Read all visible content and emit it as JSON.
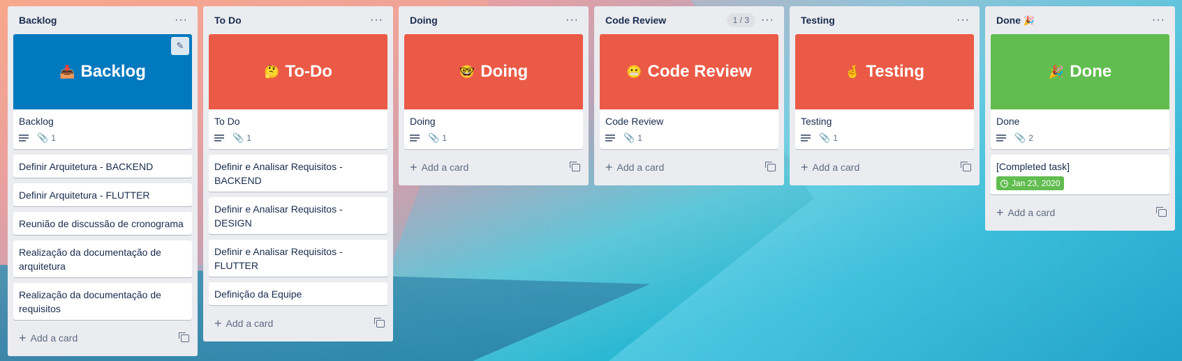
{
  "colors": {
    "blue": "#0079bf",
    "red": "#eb5a46",
    "green": "#61bd4f"
  },
  "lists": [
    {
      "title": "Backlog",
      "cover": {
        "emoji": "📥",
        "text": "Backlog"
      },
      "cover_card_title": "Backlog",
      "attachments": "1",
      "cards": [
        "Definir Arquitetura - BACKEND",
        "Definir Arquitetura - FLUTTER",
        "Reunião de discussão de cronograma",
        "Realização da documentação de arquitetura",
        "Realização da documentação de requisitos"
      ],
      "add_label": "Add a card"
    },
    {
      "title": "To Do",
      "cover": {
        "emoji": "🤔",
        "text": "To-Do"
      },
      "cover_card_title": "To Do",
      "attachments": "1",
      "cards": [
        "Definir e Analisar Requisitos - BACKEND",
        "Definir e Analisar Requisitos - DESIGN",
        "Definir e Analisar Requisitos - FLUTTER",
        "Definição da Equipe"
      ],
      "add_label": "Add a card"
    },
    {
      "title": "Doing",
      "cover": {
        "emoji": "🤓",
        "text": "Doing"
      },
      "cover_card_title": "Doing",
      "attachments": "1",
      "add_label": "Add a card"
    },
    {
      "title": "Code Review",
      "count": "1 / 3",
      "cover": {
        "emoji": "😬",
        "text": "Code Review"
      },
      "cover_card_title": "Code Review",
      "attachments": "1",
      "add_label": "Add a card"
    },
    {
      "title": "Testing",
      "cover": {
        "emoji": "🤞",
        "text": "Testing"
      },
      "cover_card_title": "Testing",
      "attachments": "1",
      "add_label": "Add a card"
    },
    {
      "title": "Done",
      "title_emoji": "🎉",
      "cover": {
        "emoji": "🎉",
        "text": "Done"
      },
      "cover_card_title": "Done",
      "attachments": "2",
      "completed_card": {
        "title": "[Completed task]",
        "due": "Jan 23, 2020"
      },
      "add_label": "Add a card"
    }
  ],
  "menu_glyph": "···",
  "edit_glyph": "✎",
  "clip_glyph": "📎",
  "plus_glyph": "+"
}
